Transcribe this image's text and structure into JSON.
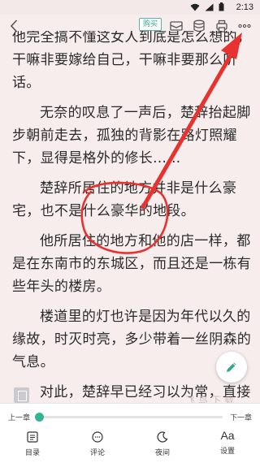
{
  "status_bar": {
    "time": "2:13",
    "icons": [
      "wifi-icon",
      "signal-icon",
      "battery-icon"
    ]
  },
  "toolbar": {
    "back_icon": "chevron-left-icon",
    "buy_label": "购买",
    "icons": [
      "envelope-icon",
      "coin-stack-icon",
      "printer-icon",
      "more-dots-icon"
    ]
  },
  "content": {
    "paragraphs": [
      {
        "text": "他完全搞不懂这女人到底是怎么想的，干嘛非要嫁给自己，干嘛非要那么听话。",
        "indent": false
      },
      {
        "text": "无奈的叹息了一声后，楚辞抬起脚步朝前走去，孤独的背影在路灯照耀下，显得是格外的修长……",
        "indent": true
      },
      {
        "text": "楚辞所居住的地方并非是什么豪宅，也不是什么豪华的地段。",
        "indent": true
      },
      {
        "text": "他所居住的地方和他的店一样，都是在东南市的东城区，而且还是一栋有些年头的楼房。",
        "indent": true
      },
      {
        "text": "楼道里的灯也许是因为年代以久的缘故，时灭时亮，多少带着一丝阴森的气息。",
        "indent": true
      },
      {
        "text": "对此，楚辞早已经习以为常，直接大楼而去。",
        "indent": true
      }
    ],
    "watermark": "飞鸟下载",
    "fab_icon": "pencil-icon"
  },
  "progress": {
    "prev_label": "上一章",
    "next_label": "下一章",
    "value": 0.01,
    "accent": "#33b38f"
  },
  "bottom_nav": [
    {
      "label": "目录",
      "icon": "list-icon"
    },
    {
      "label": "评论",
      "icon": "comment-icon"
    },
    {
      "label": "夜间",
      "icon": "moon-icon"
    },
    {
      "label": "设置",
      "icon": "font-size-icon",
      "glyph": "Aa"
    }
  ],
  "annotation": {
    "color": "#e8322f",
    "shapes": [
      "red-circle",
      "red-arrow"
    ]
  }
}
